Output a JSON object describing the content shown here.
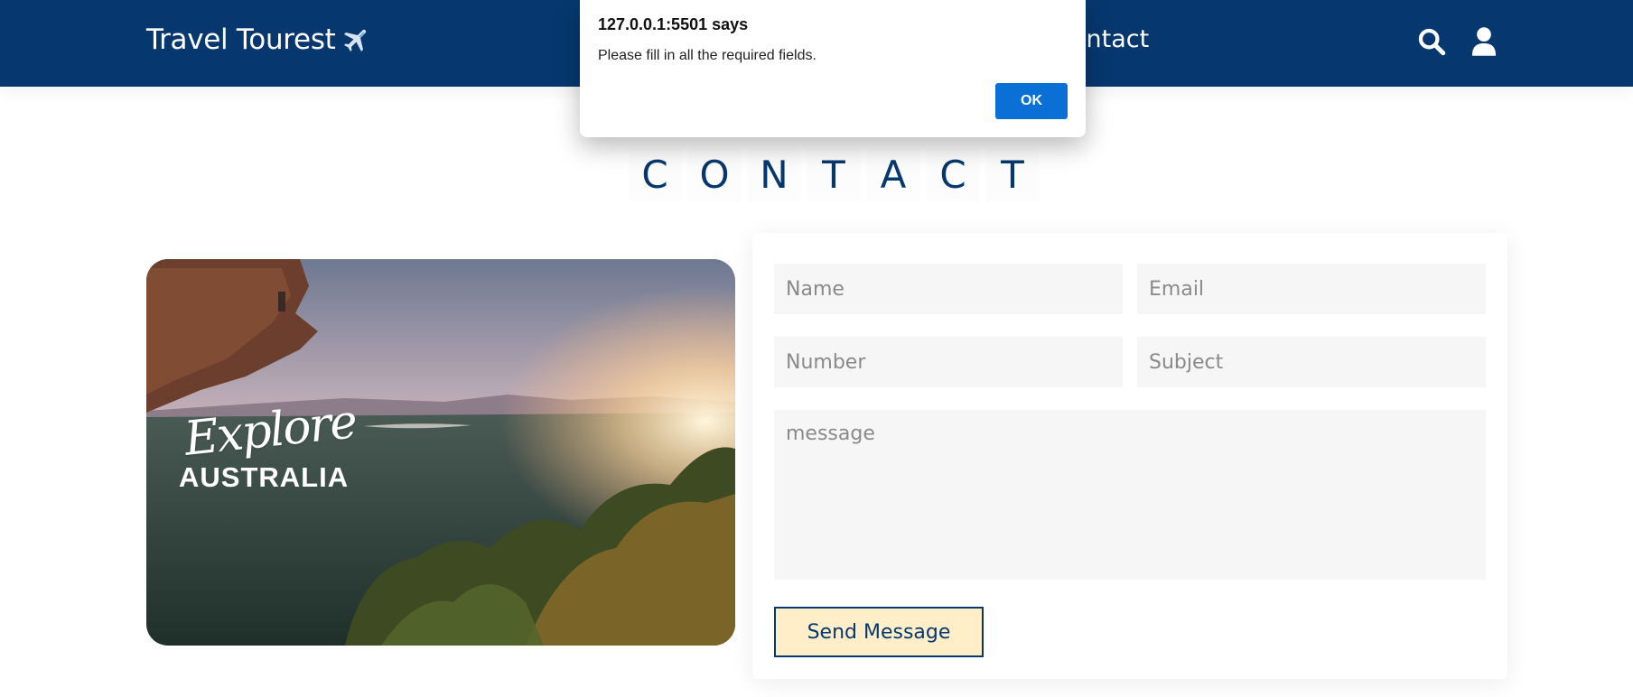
{
  "header": {
    "brand": "Travel Tourest",
    "brand_icon": "airplane-icon",
    "nav_contact": "ontact",
    "search_icon": "search-icon",
    "user_icon": "user-icon",
    "background_color": "#06386f"
  },
  "section": {
    "title_letters": [
      "C",
      "O",
      "N",
      "T",
      "A",
      "C",
      "T"
    ]
  },
  "image": {
    "script_text": "Explore",
    "country_text": "AUSTRALIA"
  },
  "form": {
    "name_placeholder": "Name",
    "email_placeholder": "Email",
    "number_placeholder": "Number",
    "subject_placeholder": "Subject",
    "message_placeholder": "message",
    "send_label": "Send Message",
    "button_background": "#ffeec8",
    "accent_color": "#06386f"
  },
  "dialog": {
    "title": "127.0.0.1:5501 says",
    "message": "Please fill in all the required fields.",
    "ok_label": "OK",
    "ok_color": "#0a70d6"
  }
}
